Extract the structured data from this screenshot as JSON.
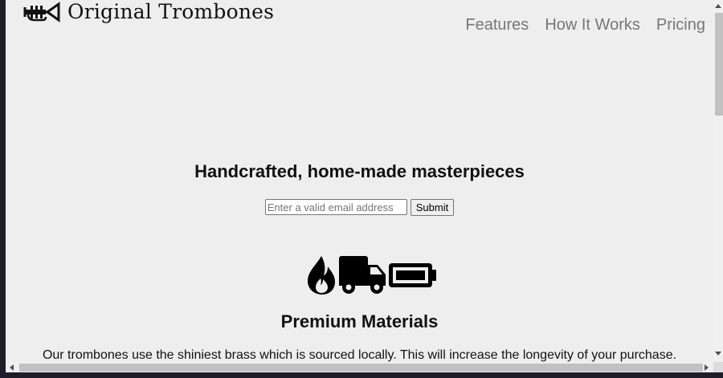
{
  "header": {
    "logo_icon": "trumpet-icon",
    "brand": "Original Trombones",
    "nav": [
      {
        "label": "Features"
      },
      {
        "label": "How It Works"
      },
      {
        "label": "Pricing"
      }
    ]
  },
  "hero": {
    "title": "Handcrafted, home-made masterpieces",
    "email_placeholder": "Enter a valid email address",
    "submit_label": "Submit"
  },
  "features": {
    "icons": [
      "fire-icon",
      "truck-icon",
      "battery-icon"
    ],
    "title": "Premium Materials",
    "description": "Our trombones use the shiniest brass which is sourced locally. This will increase the longevity of your purchase."
  },
  "colors": {
    "page_background": "#eeeeee",
    "nav_link": "#777777",
    "text": "#111111"
  }
}
